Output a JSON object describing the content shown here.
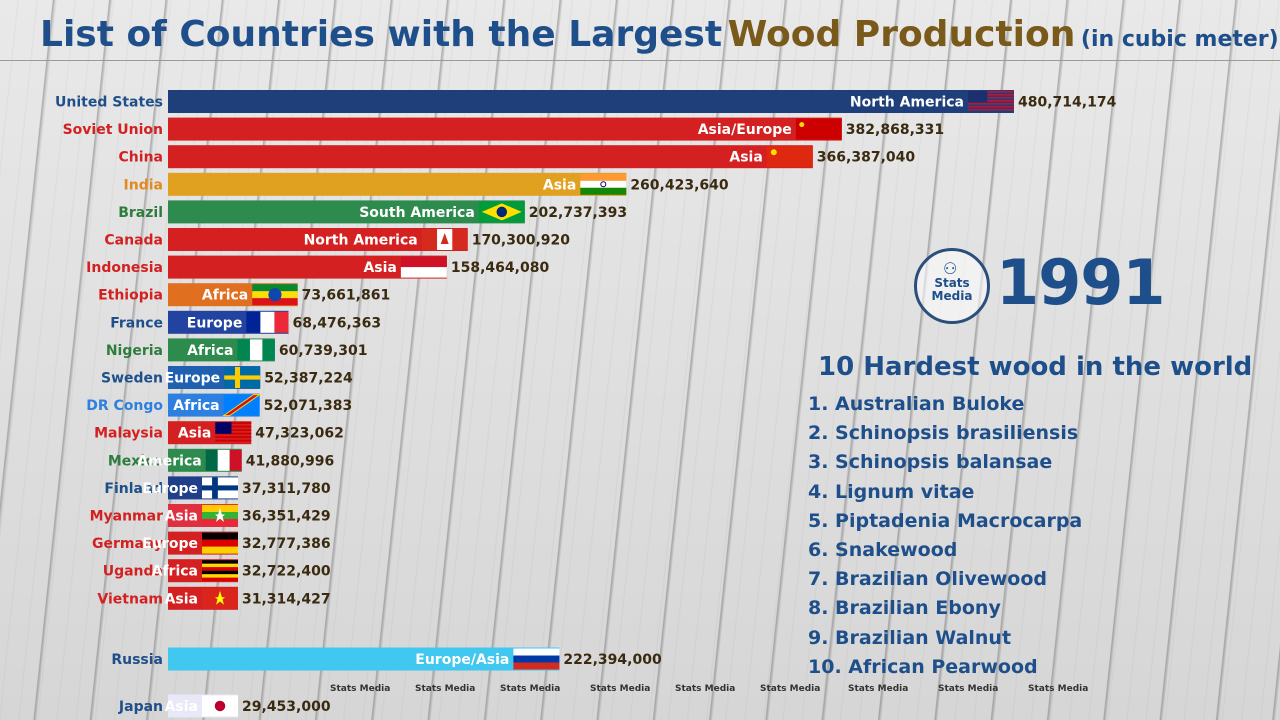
{
  "title": {
    "part1": "List of Countries with the Largest",
    "part2": "Wood Production",
    "part3": "(in cubic meter)"
  },
  "year": "1991",
  "logo": {
    "text": "Stats Media"
  },
  "hardest_woods": {
    "title": "10 Hardest wood in the world",
    "items": [
      "1. Australian Buloke",
      "2. Schinopsis brasiliensis",
      "3. Schinopsis balansae",
      "4. Lignum vitae",
      "5. Piptadenia Macrocarpa",
      "6. Snakewood",
      "7. Brazilian Olivewood",
      "8. Brazilian Ebony",
      "9. Brazilian Walnut",
      "10. African Pearwood"
    ]
  },
  "watermarks": [
    "Stats Media",
    "Stats Media",
    "Stats Media",
    "Stats Media",
    "Stats Media",
    "Stats Media",
    "Stats Media",
    "Stats Media",
    "Stats Media",
    "Stats Media"
  ],
  "colors": {
    "title_blue": "#1f4f8a",
    "title_gold": "#7a5a1a",
    "america": "#1f3f7a",
    "asia": "#d42020",
    "europe": "#2244a0",
    "africa": "#2e8b4e"
  },
  "chart_data": {
    "type": "bar",
    "orientation": "horizontal",
    "title": "List of Countries with the Largest Wood Production (in cubic meter)",
    "xlim": [
      0,
      480714174
    ],
    "rows": [
      {
        "country": "United States",
        "region": "North America",
        "value": 480714174,
        "label": "480,714,174",
        "bar": "#1f3f7a",
        "name_color": "#1f4f8a",
        "flag": "us"
      },
      {
        "country": "Soviet Union",
        "region": "Asia/Europe",
        "value": 382868331,
        "label": "382,868,331",
        "bar": "#d42020",
        "name_color": "#d42020",
        "flag": "su"
      },
      {
        "country": "China",
        "region": "Asia",
        "value": 366387040,
        "label": "366,387,040",
        "bar": "#d42020",
        "name_color": "#d42020",
        "flag": "cn"
      },
      {
        "country": "India",
        "region": "Asia",
        "value": 260423640,
        "label": "260,423,640",
        "bar": "#e0a020",
        "name_color": "#e08a20",
        "flag": "in"
      },
      {
        "country": "Brazil",
        "region": "South America",
        "value": 202737393,
        "label": "202,737,393",
        "bar": "#2e8b4e",
        "name_color": "#2e7d3e",
        "flag": "br"
      },
      {
        "country": "Canada",
        "region": "North America",
        "value": 170300920,
        "label": "170,300,920",
        "bar": "#d42020",
        "name_color": "#d42020",
        "flag": "ca"
      },
      {
        "country": "Indonesia",
        "region": "Asia",
        "value": 158464080,
        "label": "158,464,080",
        "bar": "#d42020",
        "name_color": "#d42020",
        "flag": "id"
      },
      {
        "country": "Ethiopia",
        "region": "Africa",
        "value": 73661861,
        "label": "73,661,861",
        "bar": "#e07020",
        "name_color": "#d42020",
        "flag": "et"
      },
      {
        "country": "France",
        "region": "Europe",
        "value": 68476363,
        "label": "68,476,363",
        "bar": "#2244a0",
        "name_color": "#1f4f8a",
        "flag": "fr"
      },
      {
        "country": "Nigeria",
        "region": "Africa",
        "value": 60739301,
        "label": "60,739,301",
        "bar": "#2e8b4e",
        "name_color": "#2e7d3e",
        "flag": "ng"
      },
      {
        "country": "Sweden",
        "region": "Europe",
        "value": 52387224,
        "label": "52,387,224",
        "bar": "#2060b0",
        "name_color": "#1f4f8a",
        "flag": "se"
      },
      {
        "country": "DR Congo",
        "region": "Africa",
        "value": 52071383,
        "label": "52,071,383",
        "bar": "#2e80e0",
        "name_color": "#2e80e0",
        "flag": "cd"
      },
      {
        "country": "Malaysia",
        "region": "Asia",
        "value": 47323062,
        "label": "47,323,062",
        "bar": "#d42020",
        "name_color": "#d42020",
        "flag": "my"
      },
      {
        "country": "Mexico",
        "region": "America",
        "value": 41880996,
        "label": "41,880,996",
        "bar": "#2e8b4e",
        "name_color": "#2e7d3e",
        "flag": "mx"
      },
      {
        "country": "Finland",
        "region": "Europe",
        "value": 37311780,
        "label": "37,311,780",
        "bar": "#1f3f8a",
        "name_color": "#1f4f8a",
        "flag": "fi"
      },
      {
        "country": "Myanmar",
        "region": "Asia",
        "value": 36351429,
        "label": "36,351,429",
        "bar": "#e03040",
        "name_color": "#d42020",
        "flag": "mm"
      },
      {
        "country": "Germany",
        "region": "Europe",
        "value": 32777386,
        "label": "32,777,386",
        "bar": "#d42020",
        "name_color": "#d42020",
        "flag": "de"
      },
      {
        "country": "Uganda",
        "region": "Africa",
        "value": 32722400,
        "label": "32,722,400",
        "bar": "#d42020",
        "name_color": "#d42020",
        "flag": "ug"
      },
      {
        "country": "Vietnam",
        "region": "Asia",
        "value": 31314427,
        "label": "31,314,427",
        "bar": "#d42020",
        "name_color": "#d42020",
        "flag": "vn"
      },
      {
        "country": "Russia",
        "region": "Europe/Asia",
        "value": 222394000,
        "label": "222,394,000",
        "bar": "#40c8f0",
        "name_color": "#1f4f8a",
        "flag": "ru"
      },
      {
        "country": "Japan",
        "region": "Asia",
        "value": 29453000,
        "label": "29,453,000",
        "bar": "#e8e8f8",
        "name_color": "#1f4f8a",
        "flag": "jp"
      }
    ]
  }
}
